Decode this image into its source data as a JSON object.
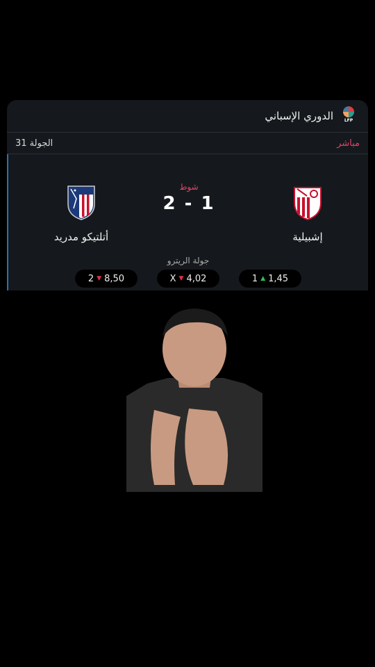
{
  "card": {
    "league_title": "الدوري الإسباني",
    "league_logo_text": "LFP",
    "status": "مباشر",
    "round": "الجولة 31",
    "period": "شوط",
    "score": "2 - 1",
    "home_team": "إشبيلية",
    "away_team": "أتلتيكو مدريد",
    "round_label": "جولة الريترو",
    "odds": [
      {
        "label": "2",
        "value": "8,50",
        "trend": "down"
      },
      {
        "label": "X",
        "value": "4,02",
        "trend": "down"
      },
      {
        "label": "1",
        "value": "1,45",
        "trend": "up"
      }
    ]
  },
  "colors": {
    "live": "#e0456a",
    "card_bg": "#15191d",
    "accent_line": "#2f6db5"
  }
}
